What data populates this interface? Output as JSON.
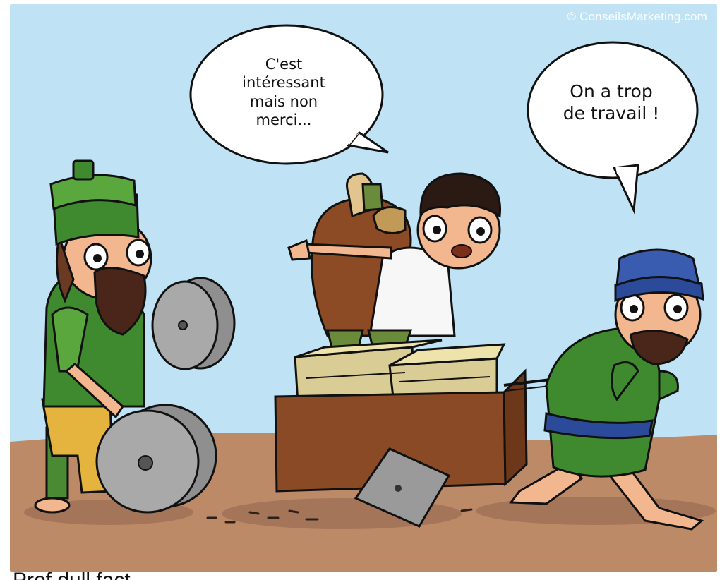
{
  "watermark": "© ConseilsMarketing.com",
  "bubble_left": {
    "lines": [
      "C'est",
      "intéressant",
      "mais non",
      "merci..."
    ]
  },
  "bubble_right": {
    "lines": [
      "On a trop",
      "de travail !"
    ]
  },
  "caption_partial": "Prof dull fact... ... ..."
}
